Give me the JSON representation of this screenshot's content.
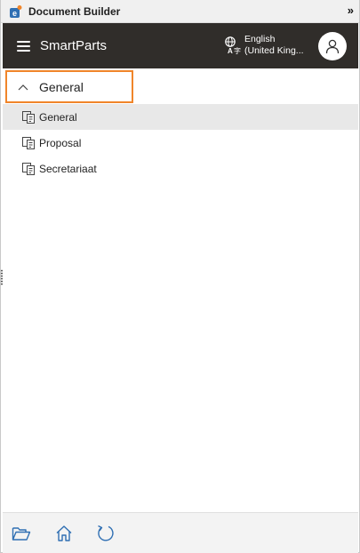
{
  "window": {
    "title": "Document Builder",
    "expand_icon": "double-chevron-right-icon"
  },
  "header": {
    "title": "SmartParts",
    "language_line1": "English",
    "language_line2": "(United King...",
    "colors": {
      "background": "#302d2a",
      "text": "#ffffff"
    }
  },
  "section": {
    "label": "General",
    "expanded": true,
    "highlight_color": "#f0852a"
  },
  "items": [
    {
      "label": "General",
      "selected": true
    },
    {
      "label": "Proposal",
      "selected": false
    },
    {
      "label": "Secretariaat",
      "selected": false
    }
  ],
  "footer": {
    "buttons": [
      "open-folder-icon",
      "home-icon",
      "refresh-icon"
    ]
  }
}
